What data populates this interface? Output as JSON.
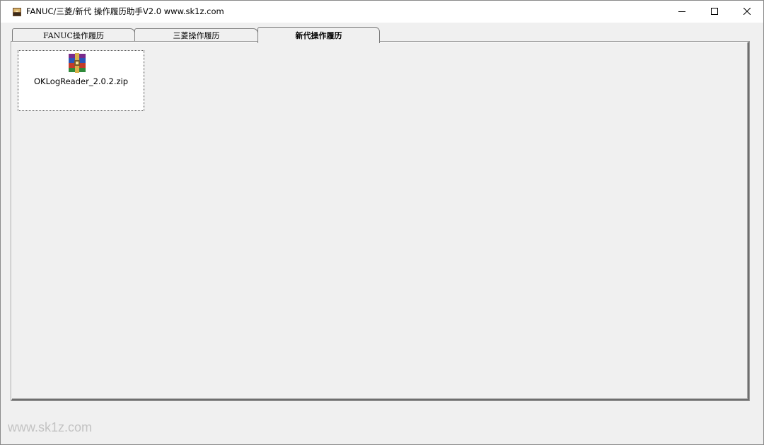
{
  "window": {
    "title": "FANUC/三菱/新代 操作履历助手V2.0    www.sk1z.com",
    "icon": "toolbox-icon",
    "controls": {
      "minimize": "minimize-icon",
      "maximize": "maximize-icon",
      "close": "close-icon"
    }
  },
  "tabs": [
    {
      "label": "FANUC操作履历",
      "active": false
    },
    {
      "label": "三菱操作履历",
      "active": false
    },
    {
      "label": "新代操作履历",
      "active": true
    }
  ],
  "files": [
    {
      "name": "OKLogReader_2.0.2.zip",
      "icon": "winrar-archive-icon"
    }
  ],
  "footer": {
    "watermark": "www.sk1z.com"
  },
  "colors": {
    "window_bg": "#f0f0f0",
    "titlebar_bg": "#ffffff",
    "list_bg": "#ffffff",
    "watermark": "#c3c3c3"
  }
}
